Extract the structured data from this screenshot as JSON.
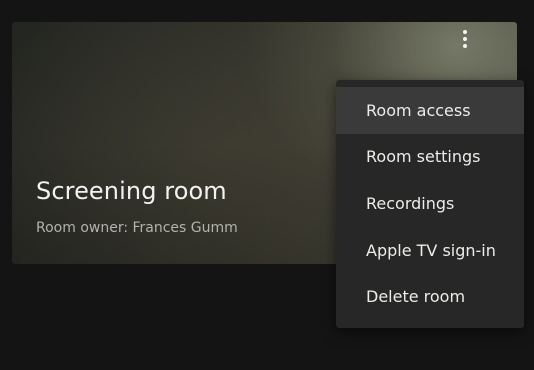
{
  "room_card": {
    "title": "Screening room",
    "owner_label": "Room owner: Frances Gumm",
    "more_icon": "more-vertical-icon"
  },
  "menu": {
    "items": [
      {
        "label": "Room access",
        "active": true
      },
      {
        "label": "Room settings",
        "active": false
      },
      {
        "label": "Recordings",
        "active": false
      },
      {
        "label": "Apple TV sign-in",
        "active": false
      },
      {
        "label": "Delete room",
        "active": false
      }
    ]
  },
  "colors": {
    "page_background": "#141414",
    "menu_background": "#272727",
    "menu_hover": "#3a3a3a",
    "text_primary": "#ecece8",
    "text_secondary": "#b3b3ad"
  }
}
